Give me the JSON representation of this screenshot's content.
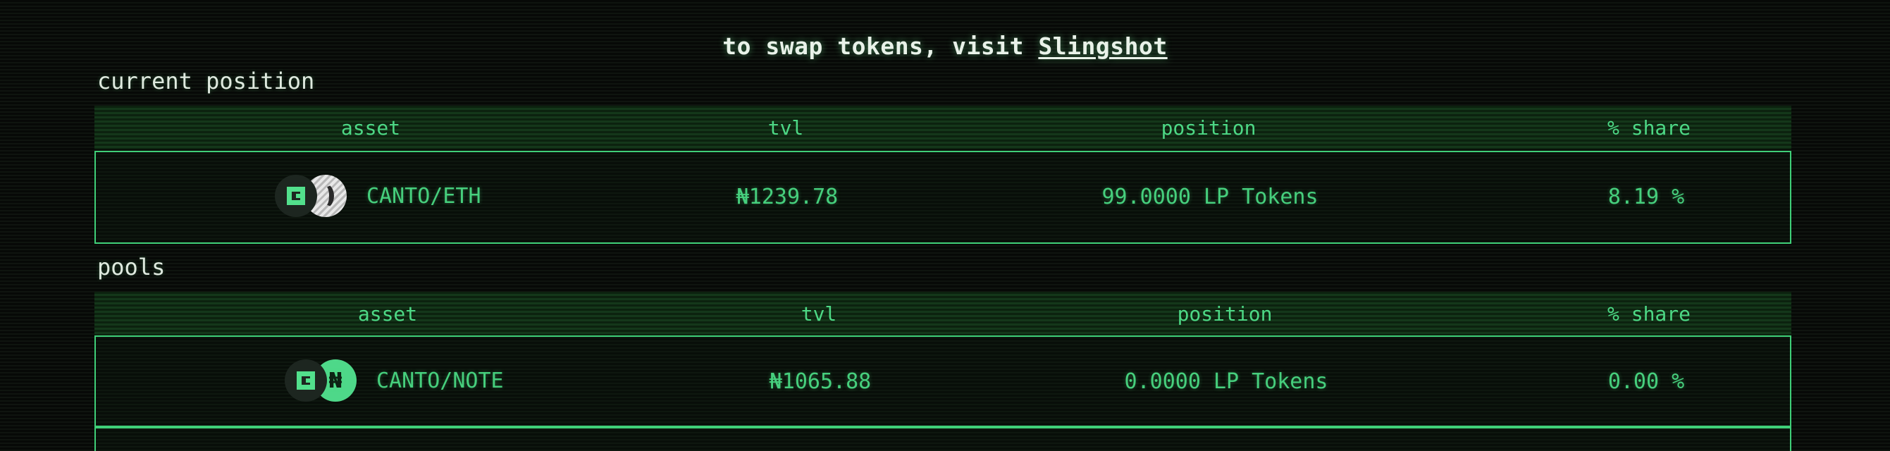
{
  "banner": {
    "text": "to swap tokens, visit",
    "link_text": "Slingshot"
  },
  "current_position": {
    "label": "current position",
    "columns": [
      "asset",
      "tvl",
      "position",
      "% share"
    ],
    "rows": [
      {
        "asset": "CANTO/ETH",
        "tokens": [
          "canto-token-icon",
          "eth-token-icon"
        ],
        "tvl": "₦1239.78",
        "position": "99.0000 LP Tokens",
        "share": "8.19 %"
      }
    ]
  },
  "pools": {
    "label": "pools",
    "columns": [
      "asset",
      "tvl",
      "position",
      "% share"
    ],
    "rows": [
      {
        "asset": "CANTO/NOTE",
        "tokens": [
          "canto-token-icon",
          "note-token-icon"
        ],
        "tvl": "₦1065.88",
        "position": "0.0000 LP Tokens",
        "share": "0.00 %"
      }
    ]
  },
  "colors": {
    "accent": "#46cf7d",
    "border": "#3fcf78",
    "header_text": "#4dd885",
    "background": "#060806",
    "text": "#e6efe6"
  }
}
